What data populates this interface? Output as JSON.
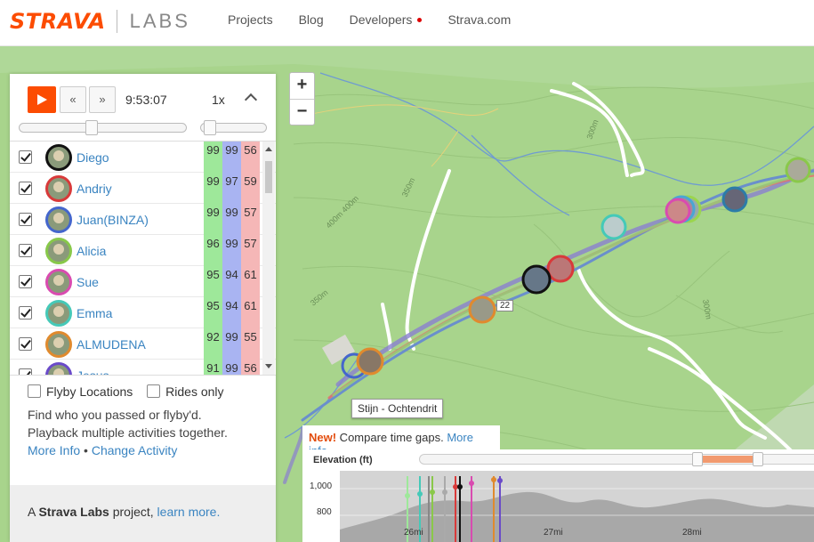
{
  "header": {
    "brand": "STRAVA",
    "labs": "LABS",
    "nav": [
      {
        "label": "Projects"
      },
      {
        "label": "Blog"
      },
      {
        "label": "Developers"
      },
      {
        "label": "Strava.com"
      }
    ]
  },
  "player": {
    "rewind_label": "«",
    "forward_label": "»",
    "time": "9:53:07",
    "speed": "1x",
    "progress_fraction": 0.42,
    "speed_fraction": 0.05
  },
  "athletes": [
    {
      "name": "Diego",
      "scores": [
        "99",
        "99",
        "56"
      ],
      "ring": "#111111"
    },
    {
      "name": "Andriy",
      "scores": [
        "99",
        "97",
        "59"
      ],
      "ring": "#d83a3a"
    },
    {
      "name": "Juan(BINZA)",
      "scores": [
        "99",
        "99",
        "57"
      ],
      "ring": "#4466cc"
    },
    {
      "name": "Alicia",
      "scores": [
        "96",
        "99",
        "57"
      ],
      "ring": "#88c84a"
    },
    {
      "name": "Sue",
      "scores": [
        "95",
        "94",
        "61"
      ],
      "ring": "#d94bb0"
    },
    {
      "name": "Emma",
      "scores": [
        "95",
        "94",
        "61"
      ],
      "ring": "#45c9b8"
    },
    {
      "name": "ALMUDENA",
      "scores": [
        "92",
        "99",
        "55"
      ],
      "ring": "#e08a2e"
    },
    {
      "name": "Jesus",
      "scores": [
        "91",
        "99",
        "56"
      ],
      "ring": "#6a4bc9"
    }
  ],
  "score_colors": [
    "#9ee89a",
    "#a9b4f2",
    "#f5b7b7"
  ],
  "options": {
    "flyby_locations": "Flyby Locations",
    "rides_only": "Rides only",
    "desc1": "Find who you passed or flyby'd.",
    "desc2": "Playback multiple activities together.",
    "more_info": "More Info",
    "bullet": "•",
    "change_activity": "Change Activity"
  },
  "footer": {
    "prefix": "A ",
    "bold": "Strava Labs",
    "middle": " project, ",
    "link": "learn more."
  },
  "map": {
    "zoom_in": "+",
    "zoom_out": "−",
    "tooltip": "Stijn - Ochtendrit",
    "small_label": "22",
    "contours": [
      "350m",
      "400m 400m",
      "350m",
      "300m",
      "300m"
    ]
  },
  "compare": {
    "new": "New!",
    "text": " Compare time gaps. ",
    "link": "More info"
  },
  "elevation": {
    "title": "Elevation (ft)",
    "y_ticks": [
      "1,000",
      "800"
    ],
    "x_ticks": [
      "26mi",
      "27mi",
      "28mi"
    ]
  }
}
